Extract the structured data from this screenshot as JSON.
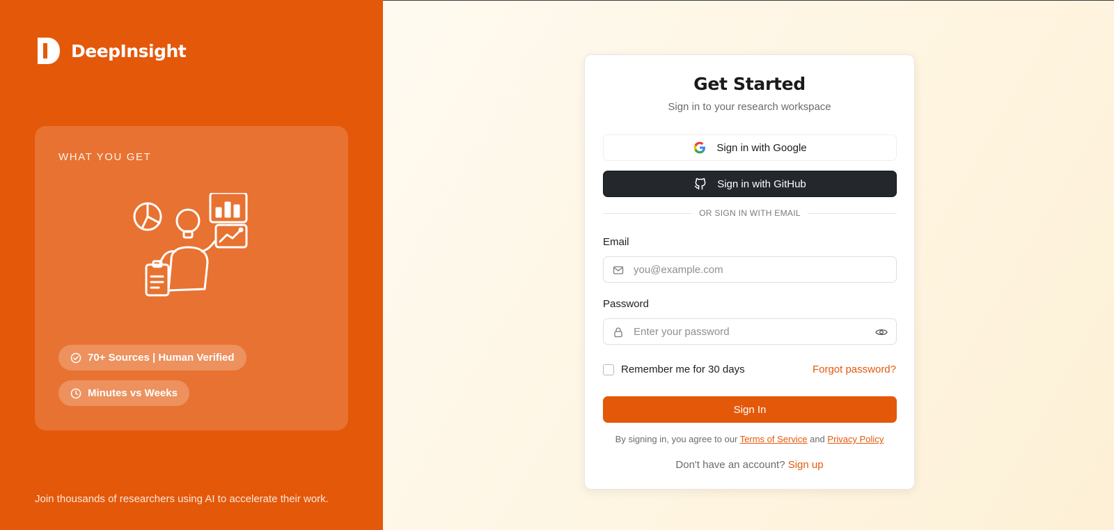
{
  "brand": {
    "name": "DeepInsight",
    "accent": "#e4580a"
  },
  "features": {
    "title": "WHAT YOU GET",
    "pills": [
      {
        "icon": "check-circle-icon",
        "label": "70+ Sources | Human Verified"
      },
      {
        "icon": "clock-icon",
        "label": "Minutes vs Weeks"
      }
    ]
  },
  "left_footer": "Join thousands of researchers using AI to accelerate their work.",
  "login": {
    "title": "Get Started",
    "subtitle": "Sign in to your research workspace",
    "google_label": "Sign in with Google",
    "github_label": "Sign in with GitHub",
    "divider": "OR SIGN IN WITH EMAIL",
    "email_label": "Email",
    "email_placeholder": "you@example.com",
    "password_label": "Password",
    "password_placeholder": "Enter your password",
    "remember_label": "Remember me for 30 days",
    "forgot_label": "Forgot password?",
    "signin_label": "Sign In",
    "terms_prefix": "By signing in, you agree to our ",
    "terms_link": "Terms of Service",
    "terms_and": " and ",
    "privacy_link": "Privacy Policy",
    "signup_prefix": "Don't have an account? ",
    "signup_link": "Sign up"
  }
}
